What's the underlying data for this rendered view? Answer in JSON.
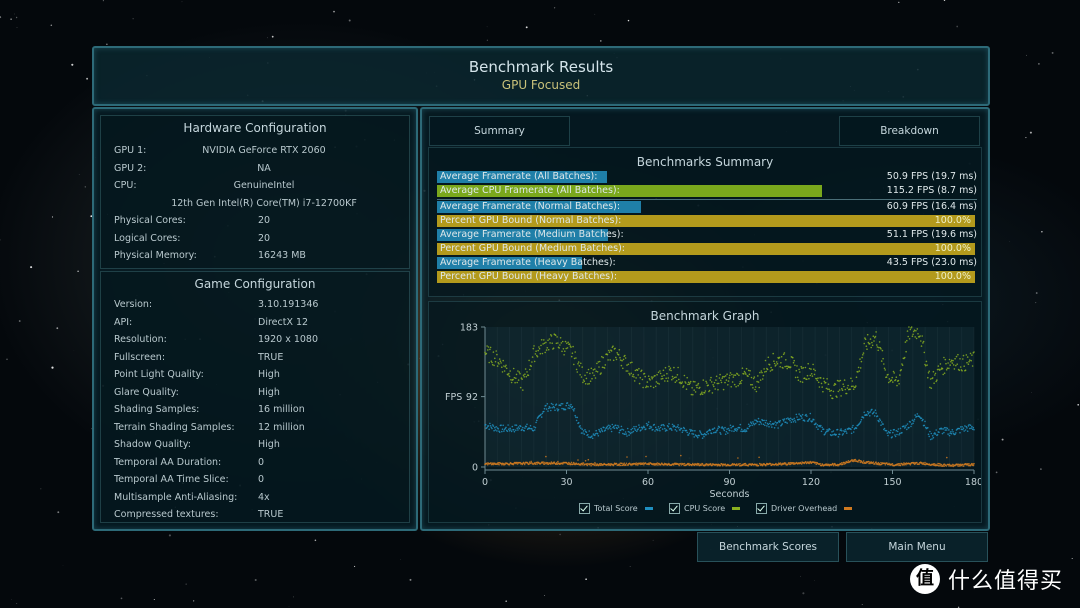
{
  "header": {
    "title": "Benchmark Results",
    "subtitle": "GPU Focused"
  },
  "hardware": {
    "title": "Hardware Configuration",
    "rows": [
      {
        "key": "GPU 1:",
        "value": "NVIDIA GeForce RTX 2060"
      },
      {
        "key": "GPU 2:",
        "value": "NA"
      },
      {
        "key": "CPU:",
        "value": "GenuineIntel"
      },
      {
        "key": "",
        "value": "12th Gen Intel(R) Core(TM) i7-12700KF"
      },
      {
        "key": "Physical Cores:",
        "value": "20"
      },
      {
        "key": "Logical Cores:",
        "value": "20"
      },
      {
        "key": "Physical Memory:",
        "value": "16243  MB"
      }
    ]
  },
  "game": {
    "title": "Game Configuration",
    "rows": [
      {
        "key": "Version:",
        "value": "3.10.191346"
      },
      {
        "key": "API:",
        "value": "DirectX 12"
      },
      {
        "key": "Resolution:",
        "value": "1920 x 1080"
      },
      {
        "key": "Fullscreen:",
        "value": "TRUE"
      },
      {
        "key": "Point Light Quality:",
        "value": "High"
      },
      {
        "key": "Glare Quality:",
        "value": "High"
      },
      {
        "key": "Shading Samples:",
        "value": "16 million"
      },
      {
        "key": "Terrain Shading Samples:",
        "value": "12 million"
      },
      {
        "key": "Shadow Quality:",
        "value": "High"
      },
      {
        "key": "Temporal AA Duration:",
        "value": "0"
      },
      {
        "key": "Temporal AA Time Slice:",
        "value": "0"
      },
      {
        "key": "Multisample Anti-Aliasing:",
        "value": "4x"
      },
      {
        "key": "Compressed textures:",
        "value": "TRUE"
      }
    ]
  },
  "tabs": {
    "summary": "Summary",
    "breakdown": "Breakdown"
  },
  "summary": {
    "title": "Benchmarks Summary",
    "bar_scale_max_fps": 161,
    "rows": [
      {
        "label": "Average Framerate (All Batches):",
        "value": "50.9 FPS (19.7 ms)",
        "fps": 50.9,
        "kind": "total"
      },
      {
        "label": "Average CPU Framerate (All Batches):",
        "value": "115.2 FPS (8.7 ms)",
        "fps": 115.2,
        "kind": "cpu"
      },
      {
        "label": "Average Framerate (Normal Batches):",
        "value": "60.9 FPS (16.4 ms)",
        "fps": 60.9,
        "kind": "total"
      },
      {
        "label": "Percent GPU Bound (Normal Batches):",
        "value": "100.0%",
        "percent": 100.0,
        "kind": "gpu"
      },
      {
        "label": "Average Framerate (Medium Batches):",
        "value": "51.1 FPS (19.6 ms)",
        "fps": 51.1,
        "kind": "total"
      },
      {
        "label": "Percent GPU Bound (Medium Batches):",
        "value": "100.0%",
        "percent": 100.0,
        "kind": "gpu"
      },
      {
        "label": "Average Framerate (Heavy Batches):",
        "value": "43.5 FPS (23.0 ms)",
        "fps": 43.5,
        "kind": "total"
      },
      {
        "label": "Percent GPU Bound (Heavy Batches):",
        "value": "100.0%",
        "percent": 100.0,
        "kind": "gpu"
      }
    ]
  },
  "colors": {
    "total": "#1f7fa8",
    "cpu": "#7aa81c",
    "gpu": "#b39a1c",
    "overhead": "#d07a20"
  },
  "buttons": {
    "scores": "Benchmark Scores",
    "menu": "Main Menu"
  },
  "watermark": {
    "logo": "值",
    "text": "什么值得买"
  },
  "chart_data": {
    "type": "scatter",
    "title": "Benchmark Graph",
    "xlabel": "Seconds",
    "ylabel": "FPS",
    "xlim": [
      0,
      180
    ],
    "ylim": [
      0,
      183
    ],
    "x_ticks": [
      "0",
      "30",
      "60",
      "90",
      "120",
      "150",
      "180"
    ],
    "y_ticks": [
      "0",
      "92",
      "183"
    ],
    "legend": [
      {
        "name": "Total Score",
        "color": "#1f8fc0",
        "checked": true
      },
      {
        "name": "CPU Score",
        "color": "#8ab020",
        "checked": true
      },
      {
        "name": "Driver Overhead",
        "color": "#d07a20",
        "checked": true
      }
    ],
    "series": [
      {
        "name": "Total Score",
        "x": [
          0,
          5,
          10,
          14,
          18,
          22,
          26,
          30,
          32,
          36,
          40,
          44,
          48,
          52,
          56,
          60,
          64,
          68,
          72,
          76,
          80,
          84,
          88,
          92,
          96,
          100,
          104,
          108,
          112,
          116,
          120,
          124,
          128,
          132,
          136,
          140,
          144,
          148,
          152,
          156,
          160,
          164,
          168,
          172,
          176,
          180
        ],
        "values": [
          55,
          50,
          50,
          52,
          50,
          78,
          78,
          80,
          82,
          45,
          42,
          48,
          52,
          45,
          50,
          55,
          50,
          52,
          50,
          44,
          42,
          50,
          47,
          52,
          50,
          60,
          58,
          55,
          62,
          65,
          65,
          48,
          44,
          45,
          50,
          72,
          70,
          42,
          45,
          55,
          70,
          40,
          48,
          45,
          50,
          52
        ]
      },
      {
        "name": "CPU Score",
        "x": [
          0,
          5,
          10,
          14,
          18,
          22,
          26,
          30,
          32,
          36,
          40,
          44,
          48,
          52,
          56,
          60,
          64,
          68,
          72,
          76,
          80,
          84,
          88,
          92,
          96,
          100,
          104,
          108,
          112,
          116,
          120,
          124,
          128,
          132,
          136,
          140,
          144,
          148,
          152,
          156,
          160,
          164,
          168,
          172,
          176,
          180
        ],
        "values": [
          150,
          140,
          120,
          110,
          148,
          160,
          165,
          155,
          150,
          120,
          118,
          140,
          150,
          135,
          120,
          110,
          115,
          125,
          118,
          100,
          105,
          108,
          112,
          115,
          120,
          108,
          135,
          140,
          138,
          120,
          128,
          110,
          100,
          105,
          108,
          160,
          170,
          120,
          110,
          175,
          178,
          110,
          130,
          140,
          135,
          140
        ]
      },
      {
        "name": "Driver Overhead",
        "x": [
          0,
          20,
          30,
          40,
          60,
          80,
          100,
          110,
          120,
          124,
          130,
          136,
          140,
          150,
          160,
          170,
          180
        ],
        "values": [
          4,
          5,
          5,
          3,
          4,
          3,
          3,
          4,
          6,
          3,
          3,
          9,
          6,
          3,
          5,
          2,
          3
        ]
      }
    ]
  }
}
